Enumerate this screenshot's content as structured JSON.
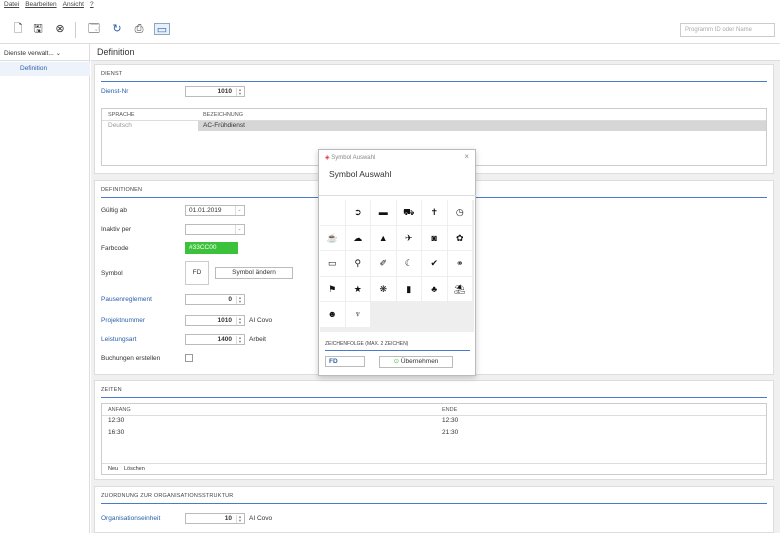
{
  "menu": {
    "datei": "Datei",
    "bearbeiten": "Bearbeiten",
    "ansicht": "Ansicht",
    "help": "?"
  },
  "search": {
    "placeholder": "Programm ID oder Name"
  },
  "nav": {
    "dropdown": "Dienste verwalt...",
    "item": "Definition"
  },
  "page": {
    "title": "Definition"
  },
  "dienst": {
    "header": "DIENST",
    "nr_label": "Dienst-Nr",
    "nr_value": "1010",
    "col_sprache": "SPRACHE",
    "col_bez": "BEZEICHNUNG",
    "row_sprache": "Deutsch",
    "row_bez": "AC-Frühdienst"
  },
  "defs": {
    "header": "DEFINITIONEN",
    "gueltig_label": "Gültig ab",
    "gueltig_value": "01.01.2019",
    "inaktiv_label": "Inaktiv per",
    "farb_label": "Farbcode",
    "farb_value": "#33CC00",
    "farb_color": "#3cc23a",
    "symbol_label": "Symbol",
    "symbol_value": "FD",
    "symbol_btn": "Symbol ändern",
    "pause_label": "Pausenreglement",
    "pause_value": "0",
    "proj_label": "Projektnummer",
    "proj_value": "1010",
    "proj_text": "AI Covo",
    "leist_label": "Leistungsart",
    "leist_value": "1400",
    "leist_text": "Arbeit",
    "buch_label": "Buchungen erstellen"
  },
  "zeiten": {
    "header": "ZEITEN",
    "col_anfang": "ANFANG",
    "col_ende": "ENDE",
    "rows": [
      {
        "anfang": "12:30",
        "ende": "12:30"
      },
      {
        "anfang": "16:30",
        "ende": "21:30"
      }
    ],
    "neu": "Neu",
    "loeschen": "Löschen"
  },
  "org": {
    "header": "ZUORDNUNG ZUR ORGANISATIONSSTRUKTUR",
    "label": "Organisationseinheit",
    "value": "10",
    "text": "AI Covo"
  },
  "dialog": {
    "titlebar": "Symbol Auswahl",
    "heading": "Symbol Auswahl",
    "zeichen_label": "ZEICHENFOLGE (MAX. 2 ZEICHEN)",
    "zeichen_value": "FD",
    "ok": "Übernehmen",
    "symbols": [
      "",
      "➲",
      "▬",
      "⛟",
      "✝",
      "◷",
      "☕",
      "☁",
      "▲",
      "✈",
      "◙",
      "✿",
      "▭",
      "⚲",
      "✐",
      "☾",
      "✔",
      "⚭",
      "⚑",
      "★",
      "❋",
      "▮",
      "♣",
      "⛱",
      "☻",
      "♆"
    ]
  }
}
